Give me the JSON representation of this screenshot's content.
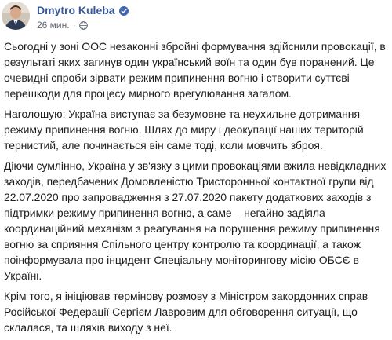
{
  "author": {
    "name": "Dmytro Kuleba",
    "verified_icon": "verified-badge-icon",
    "avatar_icon": "avatar-photo"
  },
  "meta": {
    "timestamp": "26 мин.",
    "separator": "·",
    "audience_icon": "globe-icon"
  },
  "post": {
    "paragraphs": [
      "Сьогодні у зоні ООС незаконні збройні формування здійснили провокації, в результаті яких загинув один український воїн та один був поранений. Це очевидні спроби зірвати режим припинення вогню і створити суттєві перешкоди для процесу мирного врегулювання загалом.",
      "Наголошую: Україна виступає за безумовне та неухильне дотримання режиму припинення вогню. Шлях до миру і деокупації наших територій тернистий, але починається він саме тоді, коли мовчить зброя.",
      "Діючи сумлінно, Україна у зв'язку з цими провокаціями вжила невідкладних заходів, передбачених Домовленістю Тристоронньої контактної групи від 22.07.2020 про запровадження з 27.07.2020 пакету додаткових заходів з підтримки режиму припинення вогню, а саме – негайно задіяла координаційний механізм з реагування на порушення режиму припинення вогню за сприяння Спільного центру контролю та координації, а також поінформувала про інцидент Спеціальну моніторингову місію ОБСЄ в Україні.",
      "Крім того, я ініціював термінову розмову з Міністром закордонних справ Російської Федерації Сергієм Лавровим для обговорення ситуації, що склалася, та шляхів виходу з неї."
    ]
  },
  "colors": {
    "author_link": "#385898",
    "text": "#1c1e21",
    "meta": "#616770",
    "verified": "#4267b2"
  }
}
